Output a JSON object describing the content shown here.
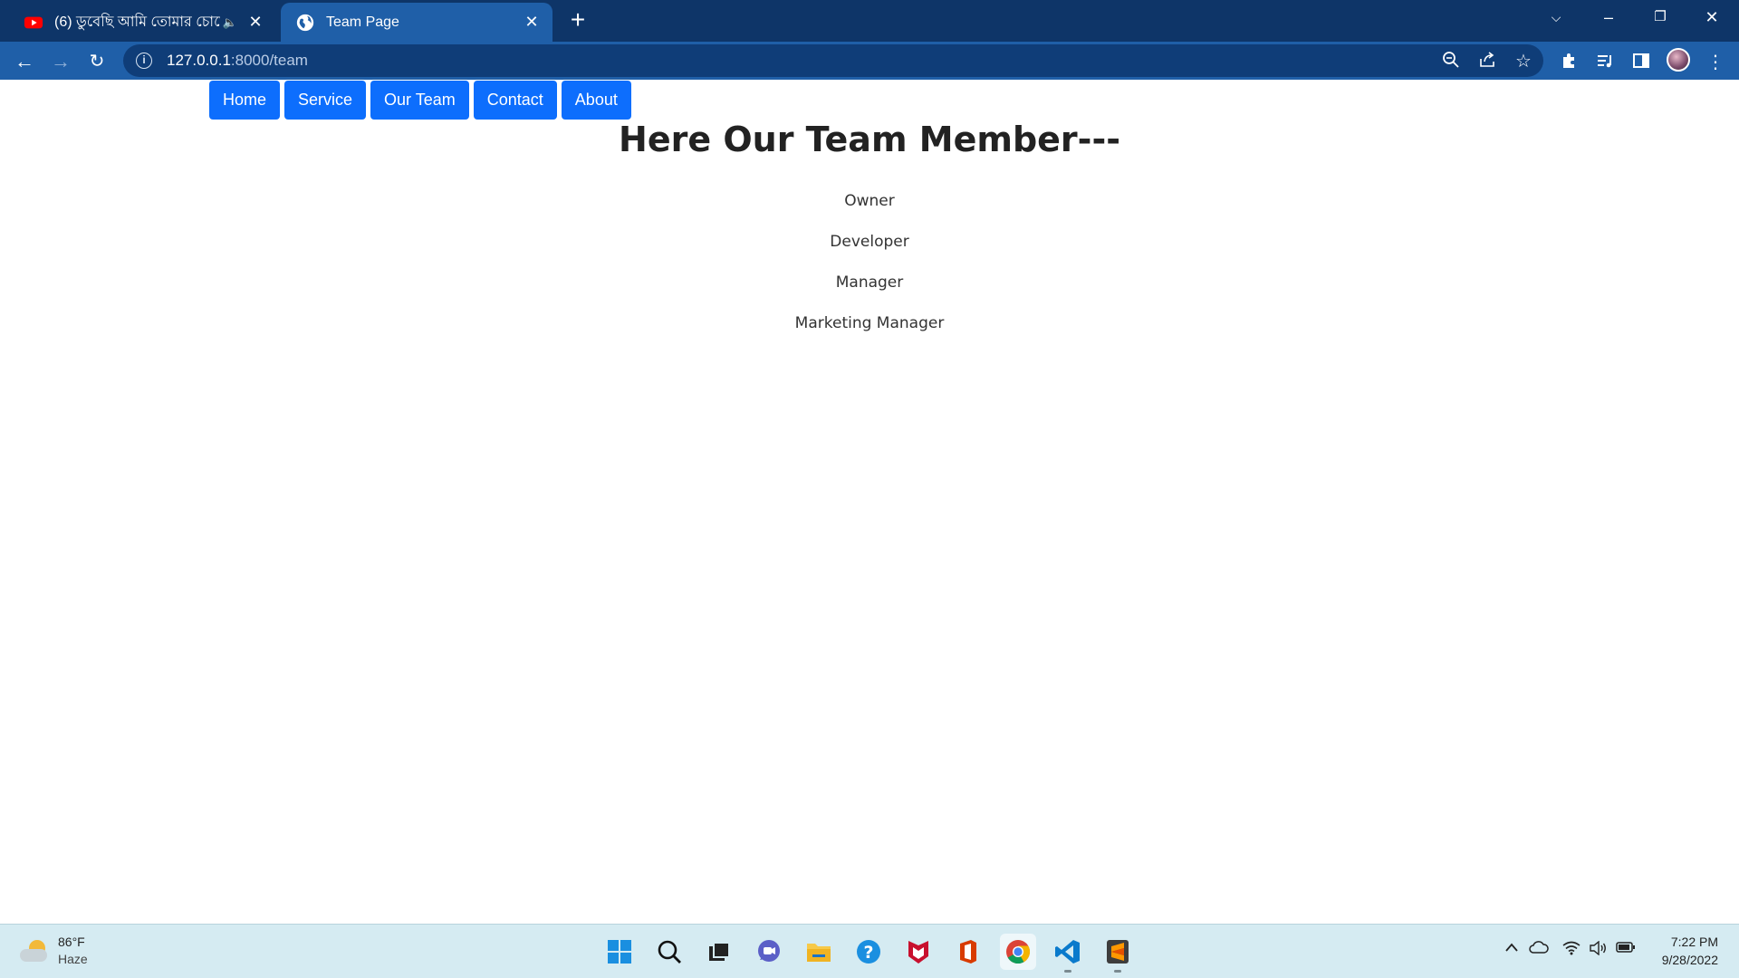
{
  "browser": {
    "tabs": [
      {
        "title": "(6) ডুবেছি আমি তোমার চোখে",
        "icon": "youtube-icon",
        "active": false
      },
      {
        "title": "Team Page",
        "icon": "globe-icon",
        "active": true
      }
    ],
    "url_host": "127.0.0.1",
    "url_path": ":8000/team"
  },
  "nav": {
    "items": [
      "Home",
      "Service",
      "Our Team",
      "Contact",
      "About"
    ],
    "color": "#0d6efd"
  },
  "content": {
    "heading": "Here Our Team Member---",
    "members": [
      "Owner",
      "Developer",
      "Manager",
      "Marketing Manager"
    ]
  },
  "taskbar": {
    "weather_temp": "86°F",
    "weather_condition": "Haze",
    "time": "7:22 PM",
    "date": "9/28/2022",
    "apps": [
      "windows-start-icon",
      "search-icon",
      "task-view-icon",
      "teams-chat-icon",
      "file-explorer-icon",
      "help-icon",
      "mcafee-icon",
      "office-icon",
      "chrome-icon",
      "vscode-icon",
      "sublime-text-icon"
    ]
  }
}
